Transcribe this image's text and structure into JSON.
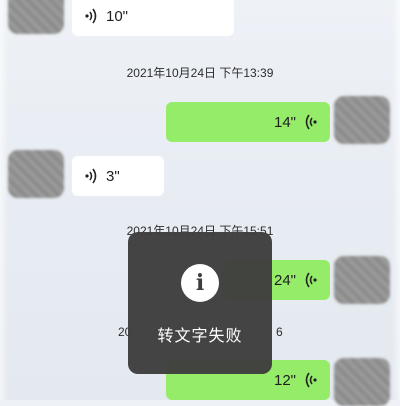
{
  "messages": [
    {
      "duration": "10\""
    },
    {
      "duration": "14\""
    },
    {
      "duration": "3\""
    },
    {
      "duration": "24\""
    },
    {
      "duration": "12\""
    }
  ],
  "timestamps": [
    "2021年10月24日 下午13:39",
    "2021年10月24日 下午15:51",
    "20",
    "6"
  ],
  "toast": {
    "icon": "info-icon",
    "text": "转文字失败"
  },
  "icons": {
    "voice_in": "voice-wave-icon",
    "voice_out": "voice-wave-icon"
  },
  "colors": {
    "outgoing_bubble": "#95ec69",
    "incoming_bubble": "#ffffff",
    "toast_bg": "#3e3e3e"
  }
}
